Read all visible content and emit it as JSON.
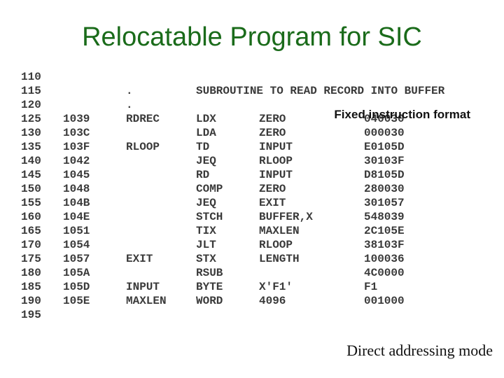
{
  "title": "Relocatable Program for SIC",
  "annotations": {
    "fixed_format": "Fixed instruction format",
    "direct_mode": "Direct addressing mode"
  },
  "listing": [
    {
      "line": "110",
      "loc": "",
      "label": "",
      "op": "",
      "operand": "",
      "obj": ""
    },
    {
      "line": "115",
      "loc": "",
      "label": ".",
      "op": "",
      "operand": "",
      "obj": "",
      "comment": "SUBROUTINE TO READ RECORD INTO BUFFER"
    },
    {
      "line": "120",
      "loc": "",
      "label": ".",
      "op": "",
      "operand": "",
      "obj": ""
    },
    {
      "line": "125",
      "loc": "1039",
      "label": "RDREC",
      "op": "LDX",
      "operand": "ZERO",
      "obj": "040030"
    },
    {
      "line": "130",
      "loc": "103C",
      "label": "",
      "op": "LDA",
      "operand": "ZERO",
      "obj": "000030"
    },
    {
      "line": "135",
      "loc": "103F",
      "label": "RLOOP",
      "op": "TD",
      "operand": "INPUT",
      "obj": "E0105D"
    },
    {
      "line": "140",
      "loc": "1042",
      "label": "",
      "op": "JEQ",
      "operand": "RLOOP",
      "obj": "30103F"
    },
    {
      "line": "145",
      "loc": "1045",
      "label": "",
      "op": "RD",
      "operand": "INPUT",
      "obj": "D8105D"
    },
    {
      "line": "150",
      "loc": "1048",
      "label": "",
      "op": "COMP",
      "operand": "ZERO",
      "obj": "280030"
    },
    {
      "line": "155",
      "loc": "104B",
      "label": "",
      "op": "JEQ",
      "operand": "EXIT",
      "obj": "301057"
    },
    {
      "line": "160",
      "loc": "104E",
      "label": "",
      "op": "STCH",
      "operand": "BUFFER,X",
      "obj": "548039"
    },
    {
      "line": "165",
      "loc": "1051",
      "label": "",
      "op": "TIX",
      "operand": "MAXLEN",
      "obj": "2C105E"
    },
    {
      "line": "170",
      "loc": "1054",
      "label": "",
      "op": "JLT",
      "operand": "RLOOP",
      "obj": "38103F"
    },
    {
      "line": "175",
      "loc": "1057",
      "label": "EXIT",
      "op": "STX",
      "operand": "LENGTH",
      "obj": "100036"
    },
    {
      "line": "180",
      "loc": "105A",
      "label": "",
      "op": "RSUB",
      "operand": "",
      "obj": "4C0000"
    },
    {
      "line": "185",
      "loc": "105D",
      "label": "INPUT",
      "op": "BYTE",
      "operand": "X'F1'",
      "obj": "F1"
    },
    {
      "line": "190",
      "loc": "105E",
      "label": "MAXLEN",
      "op": "WORD",
      "operand": "4096",
      "obj": "001000"
    },
    {
      "line": "195",
      "loc": "",
      "label": "",
      "op": "",
      "operand": "",
      "obj": ""
    }
  ]
}
